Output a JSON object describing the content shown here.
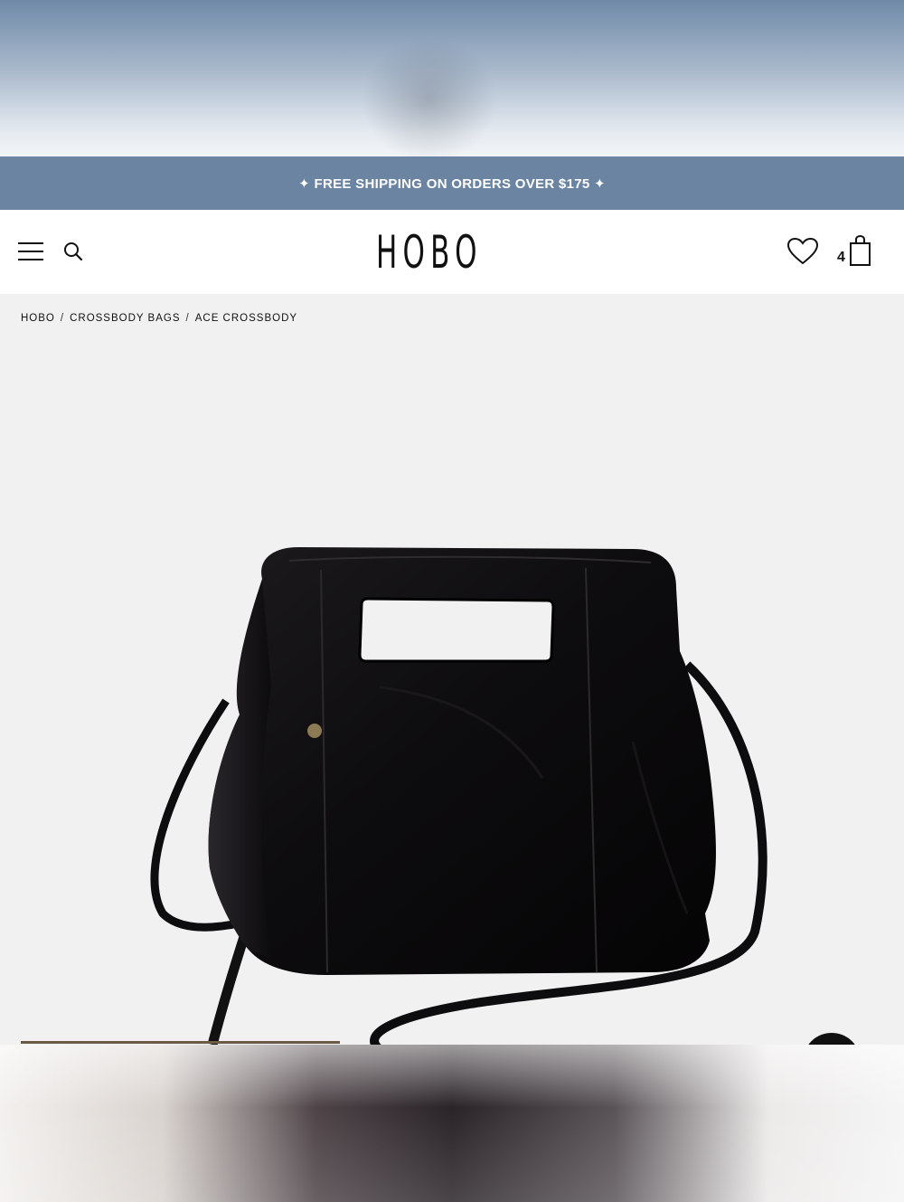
{
  "promo": {
    "text": "✦ FREE SHIPPING ON ORDERS OVER $175 ✦"
  },
  "header": {
    "logo": "HOBO",
    "cart_count": "4"
  },
  "breadcrumb": {
    "items": [
      "HOBO",
      "CROSSBODY BAGS",
      "ACE CROSSBODY"
    ],
    "separator": "/"
  },
  "gallery": {
    "progress": 0.37
  },
  "colors": {
    "promo_bg": "#6a84a2",
    "progress": "#6b5a48"
  }
}
